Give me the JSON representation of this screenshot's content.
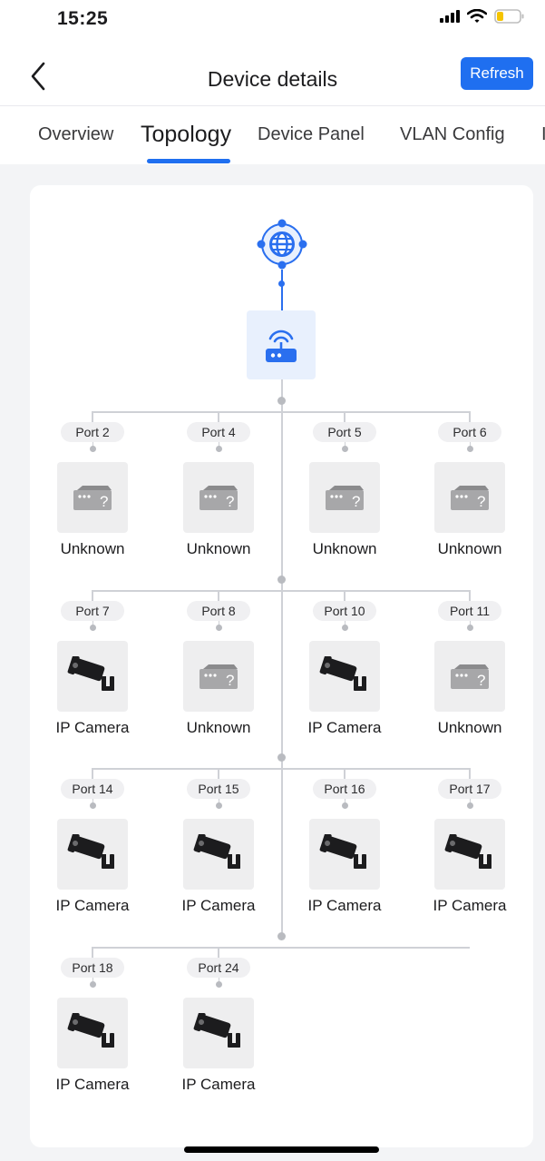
{
  "status_bar": {
    "time": "15:25"
  },
  "header": {
    "title": "Device details",
    "refresh_label": "Refresh"
  },
  "tabs": [
    {
      "label": "Overview"
    },
    {
      "label": "Topology"
    },
    {
      "label": "Device Panel"
    },
    {
      "label": "VLAN Config"
    }
  ],
  "colors": {
    "accent": "#1f6ff0",
    "tile": "#eeeeef",
    "router_tile": "#e8f0fd"
  },
  "topology": {
    "root_icon": "globe-icon",
    "device_icon": "router-icon",
    "rows": [
      [
        {
          "port": "Port 2",
          "device": "Unknown",
          "icon": "unknown-switch-icon"
        },
        {
          "port": "Port 4",
          "device": "Unknown",
          "icon": "unknown-switch-icon"
        },
        {
          "port": "Port 5",
          "device": "Unknown",
          "icon": "unknown-switch-icon"
        },
        {
          "port": "Port 6",
          "device": "Unknown",
          "icon": "unknown-switch-icon"
        }
      ],
      [
        {
          "port": "Port 7",
          "device": "IP Camera",
          "icon": "camera-icon"
        },
        {
          "port": "Port 8",
          "device": "Unknown",
          "icon": "unknown-switch-icon"
        },
        {
          "port": "Port 10",
          "device": "IP Camera",
          "icon": "camera-icon"
        },
        {
          "port": "Port 11",
          "device": "Unknown",
          "icon": "unknown-switch-icon"
        }
      ],
      [
        {
          "port": "Port 14",
          "device": "IP Camera",
          "icon": "camera-icon"
        },
        {
          "port": "Port 15",
          "device": "IP Camera",
          "icon": "camera-icon"
        },
        {
          "port": "Port 16",
          "device": "IP Camera",
          "icon": "camera-icon"
        },
        {
          "port": "Port 17",
          "device": "IP Camera",
          "icon": "camera-icon"
        }
      ],
      [
        {
          "port": "Port 18",
          "device": "IP Camera",
          "icon": "camera-icon"
        },
        {
          "port": "Port 24",
          "device": "IP Camera",
          "icon": "camera-icon"
        }
      ]
    ]
  }
}
